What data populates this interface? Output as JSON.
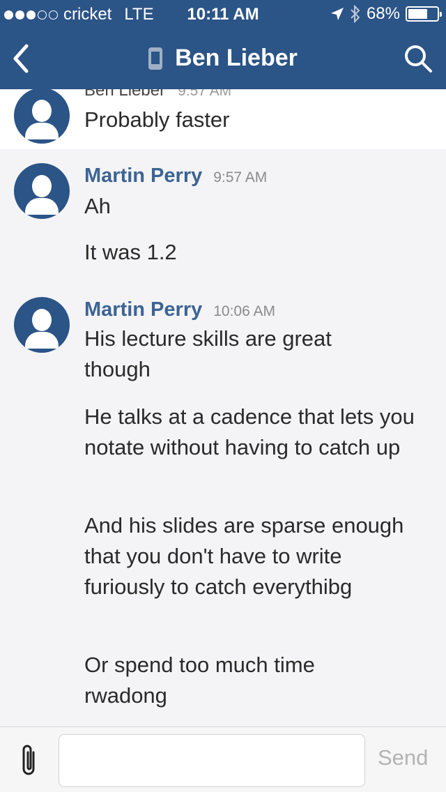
{
  "status_bar": {
    "carrier": "cricket",
    "network": "LTE",
    "time": "10:11 AM",
    "battery": "68%",
    "battery_level": 0.68
  },
  "header": {
    "title": "Ben Lieber",
    "back_icon": "chevron-left-icon",
    "device_icon": "phone-icon",
    "search_icon": "search-icon"
  },
  "messages": [
    {
      "sender": "Ben Lieber",
      "time": "9:57 AM",
      "texts": [
        "Probably faster"
      ]
    },
    {
      "sender": "Martin Perry",
      "time": "9:57 AM",
      "texts": [
        "Ah",
        "It was 1.2"
      ]
    },
    {
      "sender": "Martin Perry",
      "time": "10:06 AM",
      "texts": [
        "His lecture skills are great though",
        "He talks at a cadence that lets you notate without having to catch up",
        "And his slides are sparse enough that you don't have to write furiously to catch everythibg",
        "Or spend too much time rwadong"
      ]
    }
  ],
  "composer": {
    "placeholder": "",
    "send_label": "Send",
    "attach_icon": "paperclip-icon"
  },
  "colors": {
    "header": "#2b5487",
    "sender": "#3c6493",
    "background": "#f4f4f6"
  }
}
